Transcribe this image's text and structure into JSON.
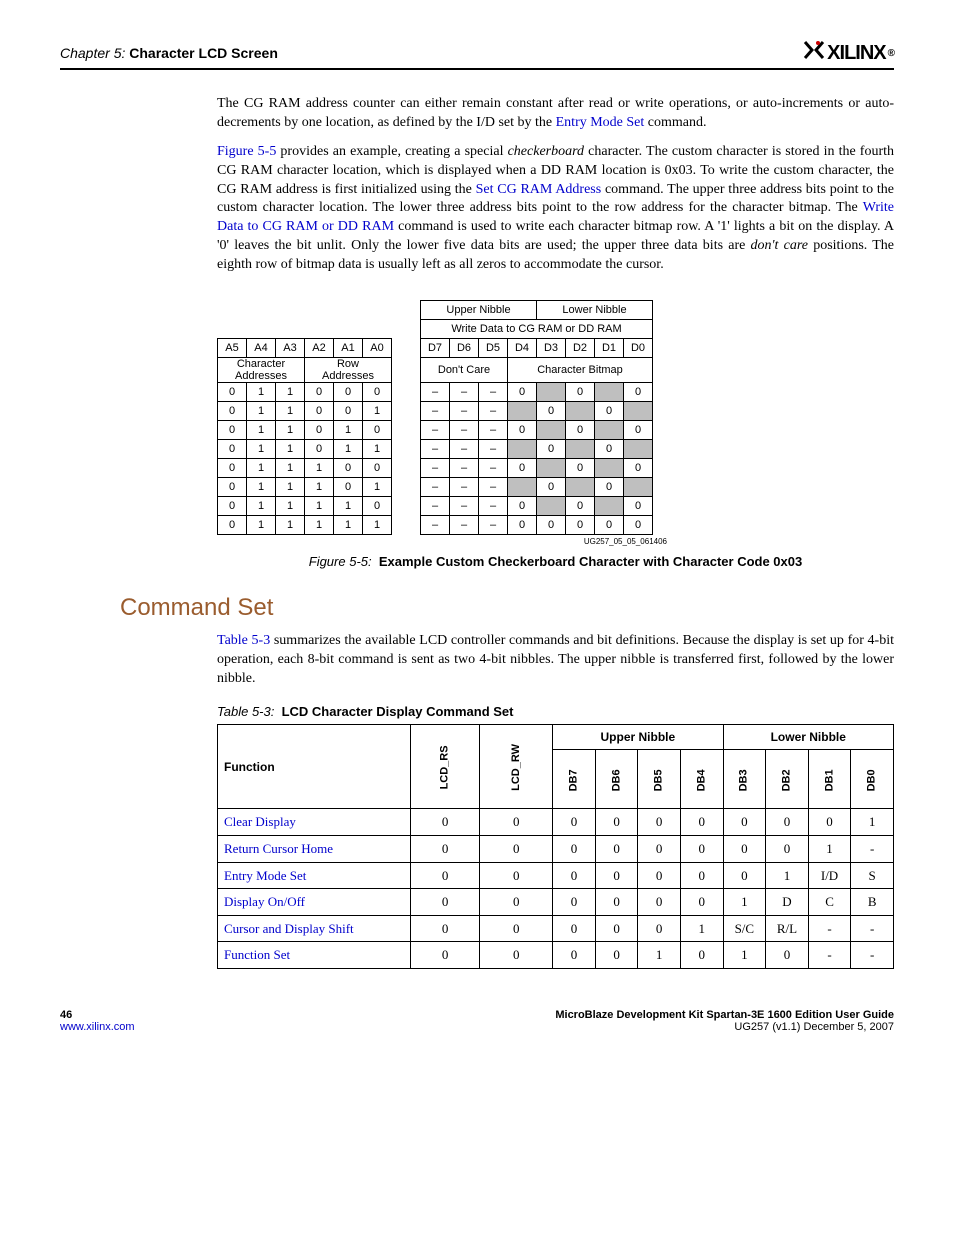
{
  "header": {
    "chapter_prefix": "Chapter 5:",
    "chapter_title": "Character LCD Screen",
    "logo_text": "XILINX",
    "logo_reg": "®"
  },
  "para1": {
    "t1": "The CG RAM address counter can either remain constant after read or write operations, or auto-increments or auto-decrements by one location, as defined by the I/D set by the ",
    "link1": "Entry Mode Set",
    "t2": " command."
  },
  "para2": {
    "link1": "Figure 5-5",
    "t1": " provides an example, creating a special ",
    "i1": "checkerboard",
    "t2": " character. The custom character is stored in the fourth CG RAM character location, which is displayed when a DD RAM location is 0x03. To write the custom character, the CG RAM address is first initialized using the ",
    "link2": "Set CG RAM Address",
    "t3": " command. The upper three address bits point to the custom character location. The lower three address bits point to the row address for the character bitmap. The ",
    "link3": "Write Data to CG RAM or DD RAM",
    "t4": " command is used to write each character bitmap row. A '1' lights a bit on the display. A '0' leaves the bit unlit. Only the lower five data bits are used; the upper three data bits are ",
    "i2": "don't care",
    "t5": " positions. The eighth row of bitmap data is usually left as all zeros to accommodate the cursor."
  },
  "figure": {
    "upper_nibble": "Upper Nibble",
    "lower_nibble": "Lower Nibble",
    "write_data": "Write Data to CG RAM or DD RAM",
    "addr_labels": [
      "A5",
      "A4",
      "A3",
      "A2",
      "A1",
      "A0"
    ],
    "data_labels": [
      "D7",
      "D6",
      "D5",
      "D4",
      "D3",
      "D2",
      "D1",
      "D0"
    ],
    "char_addr": "Character\nAddresses",
    "row_addr": "Row\nAddresses",
    "dont_care": "Don't Care",
    "char_bitmap": "Character Bitmap",
    "rows": [
      {
        "a": [
          "0",
          "1",
          "1",
          "0",
          "0",
          "0"
        ],
        "d": [
          "–",
          "–",
          "–",
          "0",
          "",
          "0",
          "",
          "0"
        ],
        "shade": [
          0,
          0,
          0,
          0,
          1,
          0,
          1,
          0
        ]
      },
      {
        "a": [
          "0",
          "1",
          "1",
          "0",
          "0",
          "1"
        ],
        "d": [
          "–",
          "–",
          "–",
          "",
          "0",
          "",
          "0",
          ""
        ],
        "shade": [
          0,
          0,
          0,
          1,
          0,
          1,
          0,
          1
        ]
      },
      {
        "a": [
          "0",
          "1",
          "1",
          "0",
          "1",
          "0"
        ],
        "d": [
          "–",
          "–",
          "–",
          "0",
          "",
          "0",
          "",
          "0"
        ],
        "shade": [
          0,
          0,
          0,
          0,
          1,
          0,
          1,
          0
        ]
      },
      {
        "a": [
          "0",
          "1",
          "1",
          "0",
          "1",
          "1"
        ],
        "d": [
          "–",
          "–",
          "–",
          "",
          "0",
          "",
          "0",
          ""
        ],
        "shade": [
          0,
          0,
          0,
          1,
          0,
          1,
          0,
          1
        ]
      },
      {
        "a": [
          "0",
          "1",
          "1",
          "1",
          "0",
          "0"
        ],
        "d": [
          "–",
          "–",
          "–",
          "0",
          "",
          "0",
          "",
          "0"
        ],
        "shade": [
          0,
          0,
          0,
          0,
          1,
          0,
          1,
          0
        ]
      },
      {
        "a": [
          "0",
          "1",
          "1",
          "1",
          "0",
          "1"
        ],
        "d": [
          "–",
          "–",
          "–",
          "",
          "0",
          "",
          "0",
          ""
        ],
        "shade": [
          0,
          0,
          0,
          1,
          0,
          1,
          0,
          1
        ]
      },
      {
        "a": [
          "0",
          "1",
          "1",
          "1",
          "1",
          "0"
        ],
        "d": [
          "–",
          "–",
          "–",
          "0",
          "",
          "0",
          "",
          "0"
        ],
        "shade": [
          0,
          0,
          0,
          0,
          1,
          0,
          1,
          0
        ]
      },
      {
        "a": [
          "0",
          "1",
          "1",
          "1",
          "1",
          "1"
        ],
        "d": [
          "–",
          "–",
          "–",
          "0",
          "0",
          "0",
          "0",
          "0"
        ],
        "shade": [
          0,
          0,
          0,
          0,
          0,
          0,
          0,
          0
        ]
      }
    ],
    "fig_id": "UG257_05_05_061406",
    "caption_label": "Figure 5-5:",
    "caption_text": "Example Custom Checkerboard Character with Character Code 0x03"
  },
  "section_heading": "Command Set",
  "para3": {
    "link1": "Table 5-3",
    "t1": " summarizes the available LCD controller commands and bit definitions. Because the display is set up for 4-bit operation, each 8-bit command is sent as two 4-bit nibbles. The upper nibble is transferred first, followed by the lower nibble."
  },
  "table53": {
    "caption_label": "Table 5-3:",
    "caption_text": "LCD Character Display Command Set",
    "headers": {
      "function": "Function",
      "lcd_rs": "LCD_RS",
      "lcd_rw": "LCD_RW",
      "upper": "Upper Nibble",
      "lower": "Lower Nibble",
      "cols": [
        "DB7",
        "DB6",
        "DB5",
        "DB4",
        "DB3",
        "DB2",
        "DB1",
        "DB0"
      ]
    },
    "rows": [
      {
        "fn": "Clear Display",
        "rs": "0",
        "rw": "0",
        "d": [
          "0",
          "0",
          "0",
          "0",
          "0",
          "0",
          "0",
          "1"
        ]
      },
      {
        "fn": "Return Cursor Home",
        "rs": "0",
        "rw": "0",
        "d": [
          "0",
          "0",
          "0",
          "0",
          "0",
          "0",
          "1",
          "-"
        ]
      },
      {
        "fn": "Entry Mode Set",
        "rs": "0",
        "rw": "0",
        "d": [
          "0",
          "0",
          "0",
          "0",
          "0",
          "1",
          "I/D",
          "S"
        ]
      },
      {
        "fn": "Display On/Off",
        "rs": "0",
        "rw": "0",
        "d": [
          "0",
          "0",
          "0",
          "0",
          "1",
          "D",
          "C",
          "B"
        ]
      },
      {
        "fn": "Cursor and Display Shift",
        "rs": "0",
        "rw": "0",
        "d": [
          "0",
          "0",
          "0",
          "1",
          "S/C",
          "R/L",
          "-",
          "-"
        ]
      },
      {
        "fn": "Function Set",
        "rs": "0",
        "rw": "0",
        "d": [
          "0",
          "0",
          "1",
          "0",
          "1",
          "0",
          "-",
          "-"
        ]
      }
    ]
  },
  "footer": {
    "page_num": "46",
    "url": "www.xilinx.com",
    "doc_title": "MicroBlaze Development Kit Spartan-3E 1600 Edition User Guide",
    "doc_id": "UG257 (v1.1) December 5, 2007"
  }
}
